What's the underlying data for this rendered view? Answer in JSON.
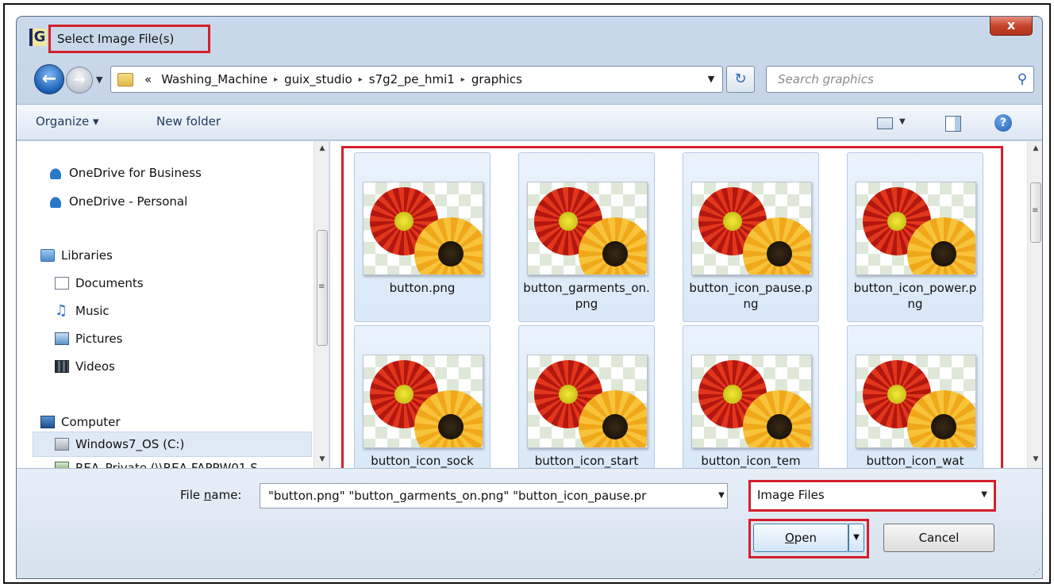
{
  "window": {
    "app_icon_letter": "G",
    "title": "Select Image File(s)",
    "close_label": "x"
  },
  "address": {
    "overflow": "«",
    "crumbs": [
      "Washing_Machine",
      "guix_studio",
      "s7g2_pe_hmi1",
      "graphics"
    ],
    "separator": "▸"
  },
  "search": {
    "placeholder": "Search graphics"
  },
  "toolbar": {
    "organize_label": "Organize ▾",
    "new_folder_label": "New folder",
    "help_label": "?"
  },
  "nav": {
    "items": [
      {
        "label": "OneDrive for Business"
      },
      {
        "label": "OneDrive - Personal"
      },
      {
        "label": "Libraries"
      },
      {
        "label": "Documents"
      },
      {
        "label": "Music"
      },
      {
        "label": "Pictures"
      },
      {
        "label": "Videos"
      },
      {
        "label": "Computer"
      },
      {
        "label": "Windows7_OS (C:)"
      },
      {
        "label": "REA_Private (\\\\REA-FAPPW01.S"
      }
    ]
  },
  "files": [
    {
      "name": "button.png"
    },
    {
      "name": "button_garments_on.png"
    },
    {
      "name": "button_icon_pause.png"
    },
    {
      "name": "button_icon_power.png"
    },
    {
      "name": "button_icon_sock"
    },
    {
      "name": "button_icon_start"
    },
    {
      "name": "button_icon_tem"
    },
    {
      "name": "button_icon_wat"
    }
  ],
  "bottom": {
    "file_name_label_pre": "File ",
    "file_name_label_u": "n",
    "file_name_label_post": "ame:",
    "file_name_value": "\"button.png\" \"button_garments_on.png\" \"button_icon_pause.pr",
    "file_type_value": "Image Files",
    "open_label_u": "O",
    "open_label_rest": "pen",
    "cancel_label": "Cancel"
  },
  "colors": {
    "highlight_red": "#d41f2a",
    "selection_blue": "#dfe9f5"
  }
}
